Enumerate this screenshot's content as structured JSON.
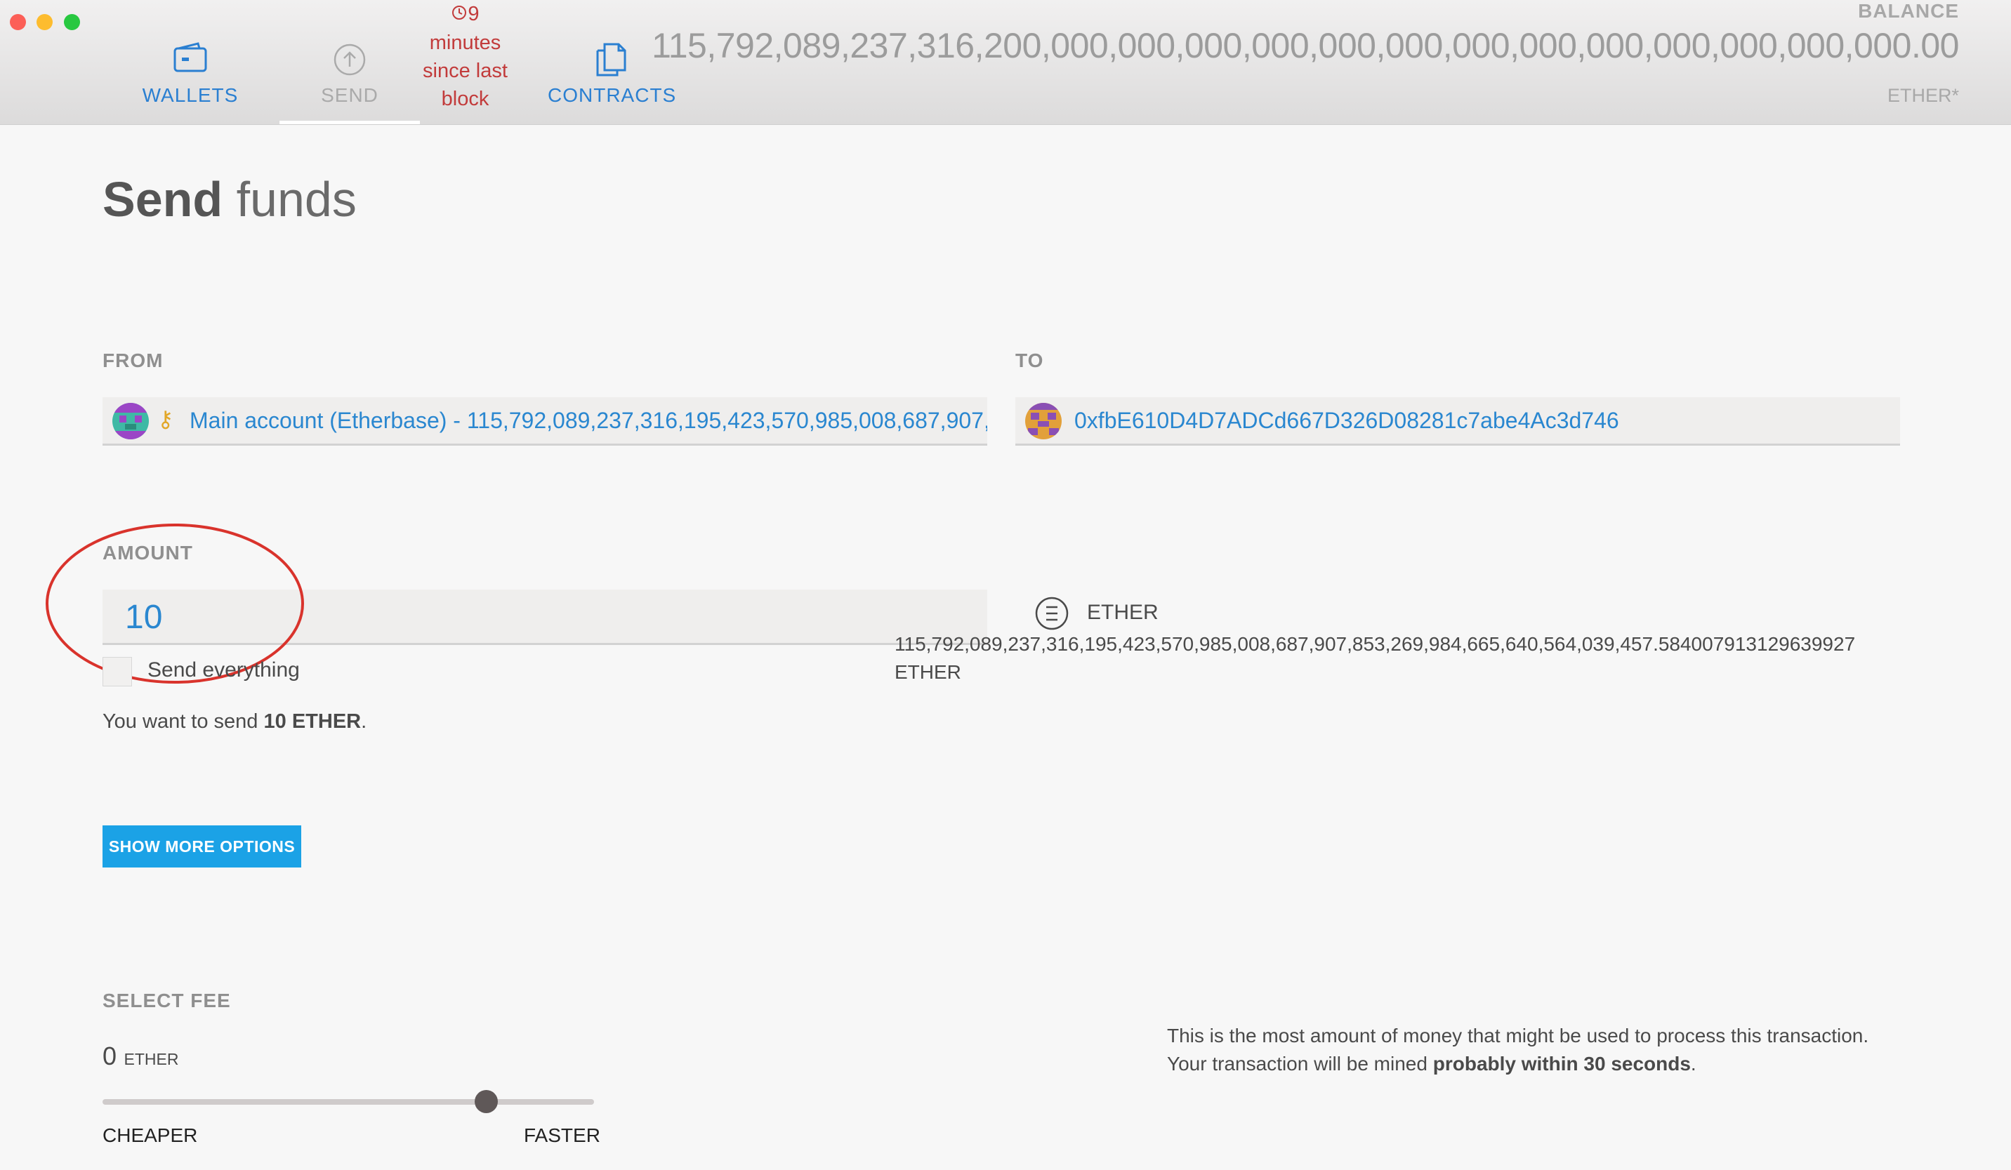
{
  "window": {
    "traffic_lights": {
      "close": "#fc5f57",
      "minimize": "#fdbc2e",
      "zoom": "#28c840"
    }
  },
  "nav": {
    "wallets": {
      "label": "WALLETS",
      "icon": "wallet-icon"
    },
    "send": {
      "label": "SEND",
      "icon": "arrow-up-circle-icon"
    },
    "contracts": {
      "label": "CONTRACTS",
      "icon": "document-icon"
    }
  },
  "block_status": {
    "icon": "clock-icon",
    "count": "9",
    "line1": "minutes",
    "line2": "since last",
    "line3": "block"
  },
  "balance": {
    "label": "BALANCE",
    "value": "115,792,089,237,316,200,000,000,000,000,000,000,000,000,000,000,000,000,000.00",
    "unit": "ETHER*"
  },
  "page": {
    "title_bold": "Send",
    "title_light": "funds"
  },
  "from": {
    "label": "FROM",
    "account_key_icon": "key-icon",
    "account_text": "Main account (Etherbase) - 115,792,089,237,316,195,423,570,985,008,687,907,"
  },
  "to": {
    "label": "TO",
    "address": "0xfbE610D4D7ADCd667D326D08281c7abe4Ac3d746"
  },
  "amount": {
    "label": "AMOUNT",
    "value": "10",
    "currency_icon": "ether-icon",
    "currency": "ETHER",
    "send_everything_label": "Send everything",
    "available_line1": "115,792,089,237,316,195,423,570,985,008,687,907,853,269,984,665,640,564,039,457.584007913129639927",
    "available_line2": "ETHER",
    "summary_prefix": "You want to send ",
    "summary_amount": "10 ETHER",
    "summary_suffix": "."
  },
  "options": {
    "show_more_label": "SHOW MORE OPTIONS"
  },
  "fee": {
    "label": "SELECT FEE",
    "value": "0",
    "unit": "ETHER",
    "cheaper_label": "CHEAPER",
    "faster_label": "FASTER",
    "slider_level": 0.78,
    "info_line1": "This is the most amount of money that might be used to process this transaction.",
    "info_line2_prefix": "Your transaction will be mined ",
    "info_line2_bold": "probably within 30 seconds",
    "info_line2_suffix": "."
  },
  "colors": {
    "accent_blue": "#1ba2e6",
    "link_blue": "#2a87d0",
    "alert_red": "#c23b3b",
    "annotation_red": "#d9332c"
  }
}
